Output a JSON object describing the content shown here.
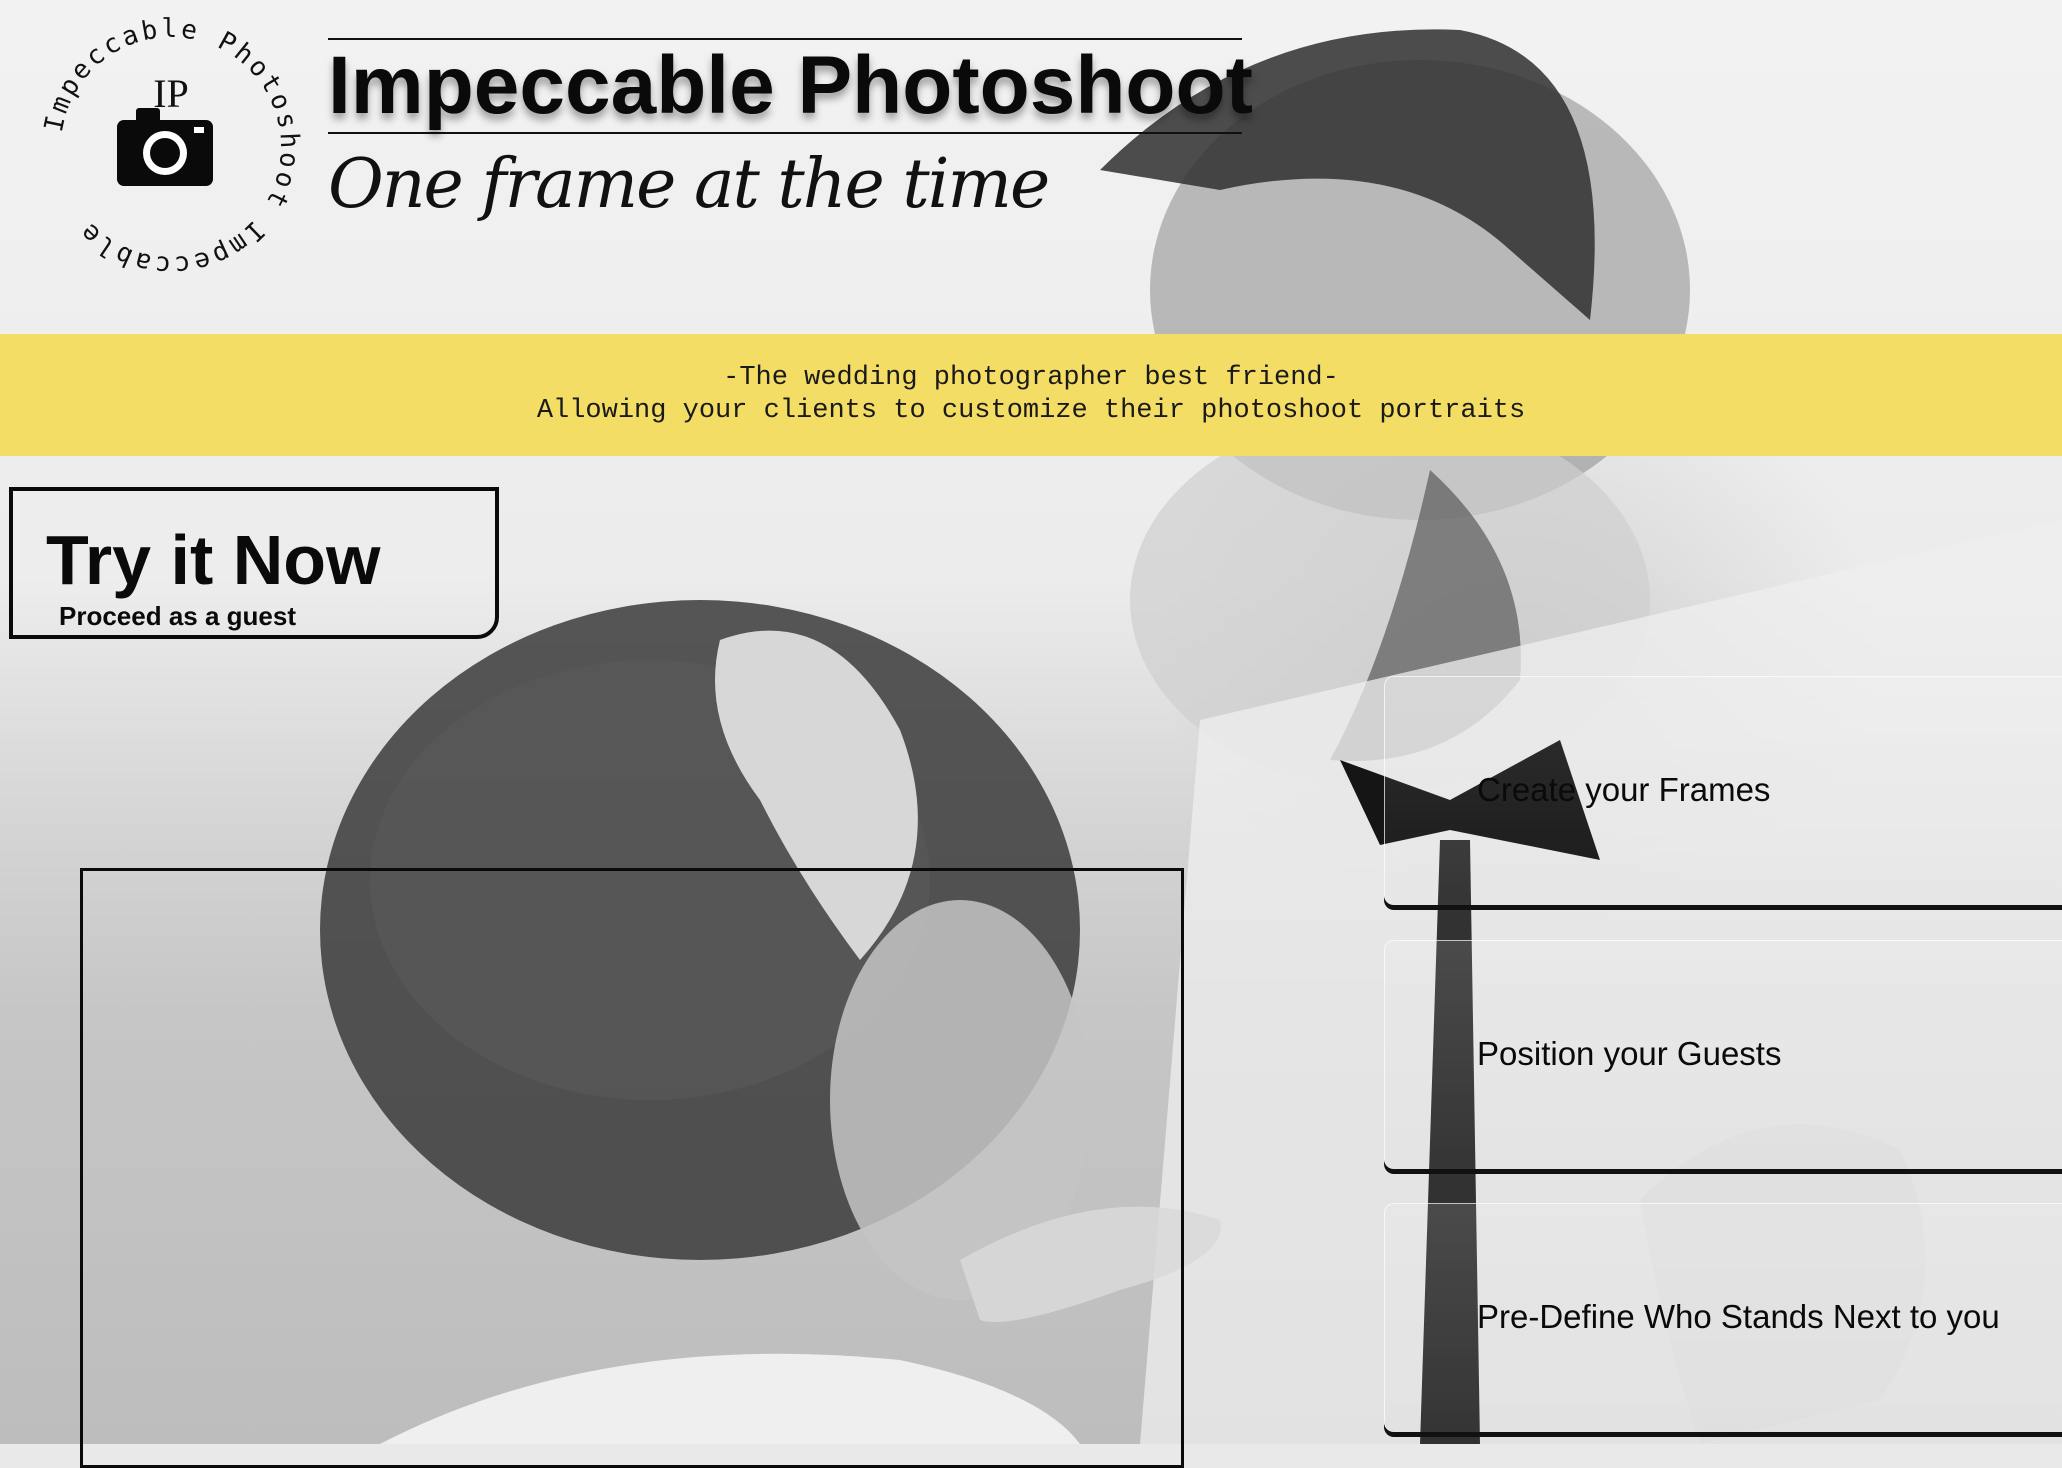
{
  "brand": {
    "title": "Impeccable Photoshoot",
    "tagline": "One frame at the time",
    "logo_initials": "IP",
    "logo_ring_text": "Impeccable Photoshoot Impeccable",
    "logo_icon": "camera-icon"
  },
  "banner": {
    "line1": "-The wedding photographer best friend-",
    "line2": "Allowing your clients to customize their photoshoot portraits",
    "color": "#f4dd65"
  },
  "try_it": {
    "title": "Try it Now",
    "subtitle": "Proceed as a guest"
  },
  "features": [
    {
      "label": "Create your Frames"
    },
    {
      "label": "Position your Guests"
    },
    {
      "label": "Pre-Define Who Stands Next to you"
    }
  ]
}
